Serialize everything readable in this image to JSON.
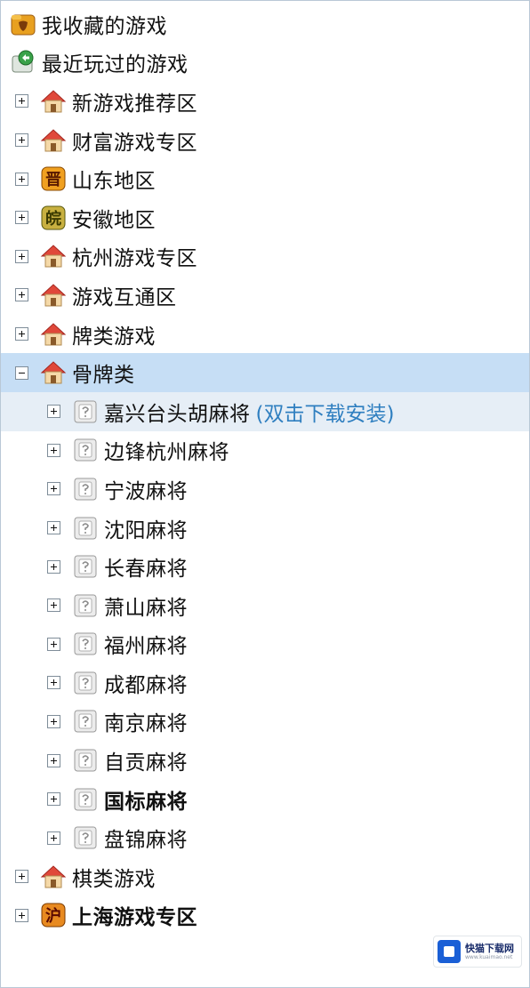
{
  "tree": {
    "favorites": "我收藏的游戏",
    "recent": "最近玩过的游戏",
    "new_games": "新游戏推荐区",
    "wealth_games": "财富游戏专区",
    "shandong": "山东地区",
    "shandong_badge": "晋",
    "anhui": "安徽地区",
    "anhui_badge": "皖",
    "hangzhou": "杭州游戏专区",
    "interconnect": "游戏互通区",
    "card_games": "牌类游戏",
    "bone_cards": "骨牌类",
    "mahjong": [
      {
        "label": "嘉兴台头胡麻将",
        "note": "(双击下载安装)"
      },
      {
        "label": "边锋杭州麻将"
      },
      {
        "label": "宁波麻将"
      },
      {
        "label": "沈阳麻将"
      },
      {
        "label": "长春麻将"
      },
      {
        "label": "萧山麻将"
      },
      {
        "label": "福州麻将"
      },
      {
        "label": "成都麻将"
      },
      {
        "label": "南京麻将"
      },
      {
        "label": "自贡麻将"
      },
      {
        "label": "国标麻将"
      },
      {
        "label": "盘锦麻将"
      }
    ],
    "chess_games": "棋类游戏",
    "shanghai": "上海游戏专区",
    "shanghai_badge": "沪"
  },
  "watermark": {
    "title": "快猫下载网",
    "sub": "www.kuaimao.net"
  },
  "colors": {
    "selected_row": "#c6def5",
    "hover_row": "#e6eef6",
    "note_text": "#2f7fc0"
  }
}
